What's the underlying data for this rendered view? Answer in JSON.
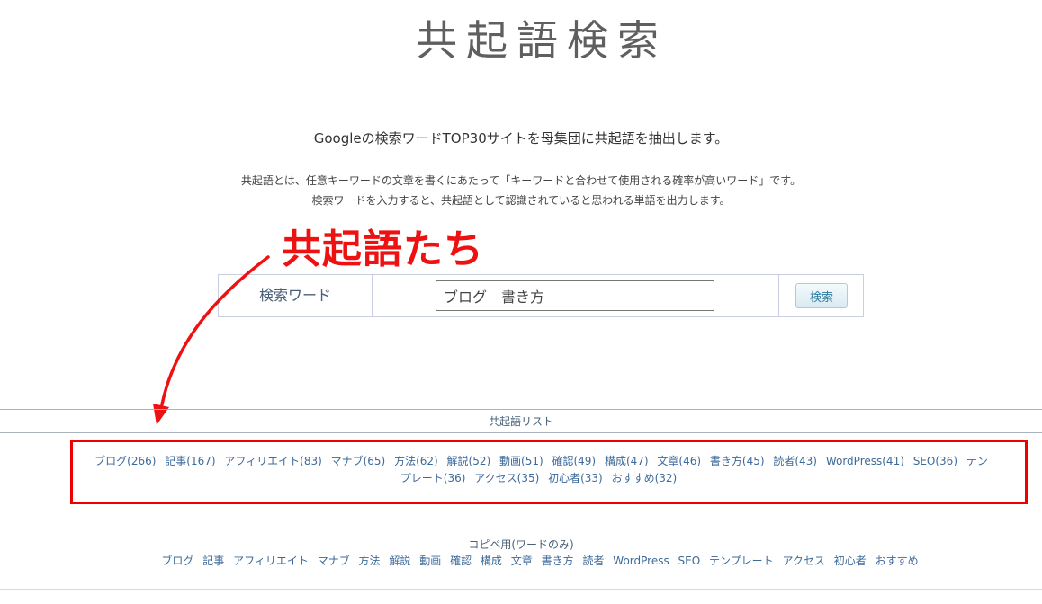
{
  "logo": {
    "text": "共起語検索"
  },
  "lead": "Googleの検索ワードTOP30サイトを母集団に共起語を抽出します。",
  "description": [
    "共起語とは、任意キーワードの文章を書くにあたって「キーワードと合わせて使用される確率が高いワード」です。",
    "検索ワードを入力すると、共起語として認識されていると思われる単語を出力します。"
  ],
  "annotation": {
    "callout": "共起語たち",
    "color": "#ee1111"
  },
  "search": {
    "label": "検索ワード",
    "value": "ブログ　書き方",
    "button_label": "検索"
  },
  "cooccurrence": {
    "title": "共起語リスト",
    "items": [
      "ブログ(266)",
      "記事(167)",
      "アフィリエイト(83)",
      "マナブ(65)",
      "方法(62)",
      "解説(52)",
      "動画(51)",
      "確認(49)",
      "構成(47)",
      "文章(46)",
      "書き方(45)",
      "読者(43)",
      "WordPress(41)",
      "SEO(36)",
      "テンプレート(36)",
      "アクセス(35)",
      "初心者(33)",
      "おすすめ(32)"
    ]
  },
  "copy": {
    "title": "コピペ用(ワードのみ)",
    "items": [
      "ブログ",
      "記事",
      "アフィリエイト",
      "マナブ",
      "方法",
      "解説",
      "動画",
      "確認",
      "構成",
      "文章",
      "書き方",
      "読者",
      "WordPress",
      "SEO",
      "テンプレート",
      "アクセス",
      "初心者",
      "おすすめ"
    ]
  }
}
